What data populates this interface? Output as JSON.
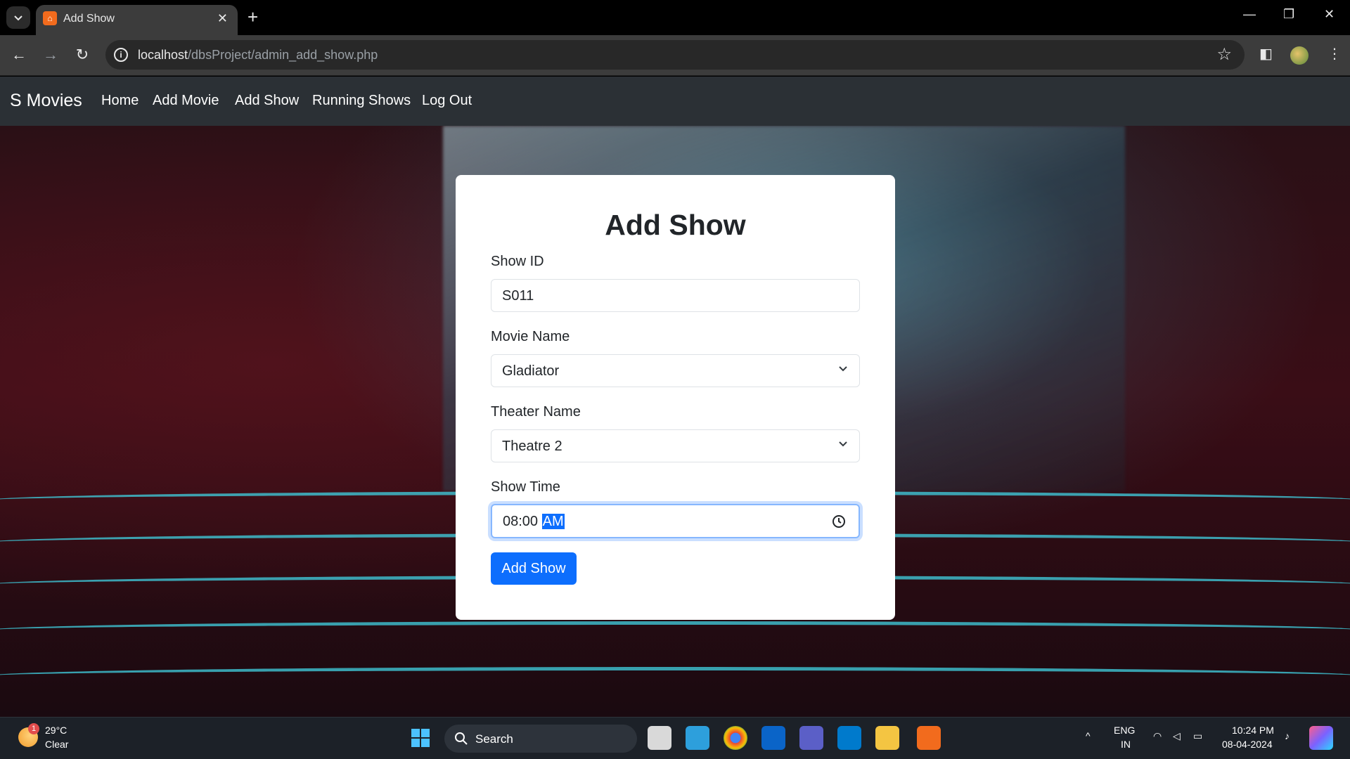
{
  "browser": {
    "tab_title": "Add Show",
    "url_host": "localhost",
    "url_path": "/dbsProject/admin_add_show.php"
  },
  "site": {
    "brand": "S Movies",
    "nav": [
      "Home",
      "Add Movie",
      "Add Show",
      "Running Shows",
      "Log Out"
    ]
  },
  "form": {
    "title": "Add Show",
    "show_id_label": "Show ID",
    "show_id_value": "S011",
    "movie_label": "Movie Name",
    "movie_value": "Gladiator",
    "theater_label": "Theater Name",
    "theater_value": "Theatre 2",
    "time_label": "Show Time",
    "time_hours": "08:00",
    "time_period": "AM",
    "submit_label": "Add Show"
  },
  "taskbar": {
    "weather_temp": "29°C",
    "weather_cond": "Clear",
    "weather_badge": "1",
    "search_label": "Search",
    "lang_top": "ENG",
    "lang_bottom": "IN",
    "time": "10:24 PM",
    "date": "08-04-2024"
  },
  "colors": {
    "primary": "#0d6efd",
    "navbar": "#2b3035",
    "focus_ring": "#86b7fe"
  },
  "icons": [
    "tab-search-icon",
    "xampp-favicon",
    "close-icon",
    "plus-icon",
    "back-arrow-icon",
    "forward-arrow-icon",
    "reload-icon",
    "info-icon",
    "star-icon",
    "sidebar-icon",
    "profile-avatar",
    "menu-dots-icon",
    "chevron-down-icon",
    "clock-icon",
    "windows-start-icon",
    "search-icon",
    "wifi-icon",
    "volume-icon",
    "battery-icon",
    "bell-icon"
  ]
}
